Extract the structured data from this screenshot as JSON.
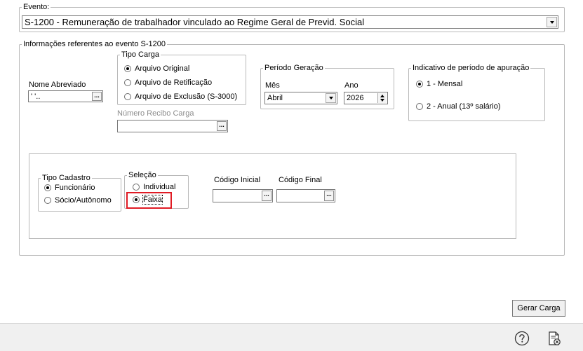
{
  "evento": {
    "legend": "Evento:",
    "selected": "S-1200 - Remuneração de trabalhador vinculado ao Regime Geral de Previd. Social"
  },
  "informacoes": {
    "legend": "Informações referentes ao evento S-1200",
    "nome_abreviado": {
      "label": "Nome Abreviado",
      "value": "' '..",
      "button": "..."
    },
    "tipo_carga": {
      "legend": "Tipo Carga",
      "options": [
        "Arquivo Original",
        "Arquivo de Retificação",
        "Arquivo de Exclusão (S-3000)"
      ],
      "selected_index": 0
    },
    "numero_recibo": {
      "label": "Número Recibo Carga",
      "value": "",
      "button": "..."
    },
    "periodo_geracao": {
      "legend": "Período Geração",
      "mes_label": "Mês",
      "mes_value": "Abril",
      "ano_label": "Ano",
      "ano_value": "2026"
    },
    "indicativo": {
      "legend": "Indicativo de período de apuração",
      "options": [
        "1 - Mensal",
        "2 - Anual (13º salário)"
      ],
      "selected_index": 0
    }
  },
  "filtro": {
    "tipo_cadastro": {
      "legend": "Tipo Cadastro",
      "options": [
        "Funcionário",
        "Sócio/Autônomo"
      ],
      "selected_index": 0
    },
    "selecao": {
      "legend": "Seleção",
      "options": [
        "Individual",
        "Faixa"
      ],
      "selected_index": 1
    },
    "codigo_inicial": {
      "label": "Código Inicial",
      "value": "",
      "button": "..."
    },
    "codigo_final": {
      "label": "Código Final",
      "value": "",
      "button": "..."
    }
  },
  "actions": {
    "gerar_carga": "Gerar Carga"
  },
  "colors": {
    "highlight": "#e01b24",
    "border": "#b9b9b9",
    "bar": "#f0f0f0"
  },
  "icons": [
    "help-icon",
    "document-close-icon"
  ]
}
